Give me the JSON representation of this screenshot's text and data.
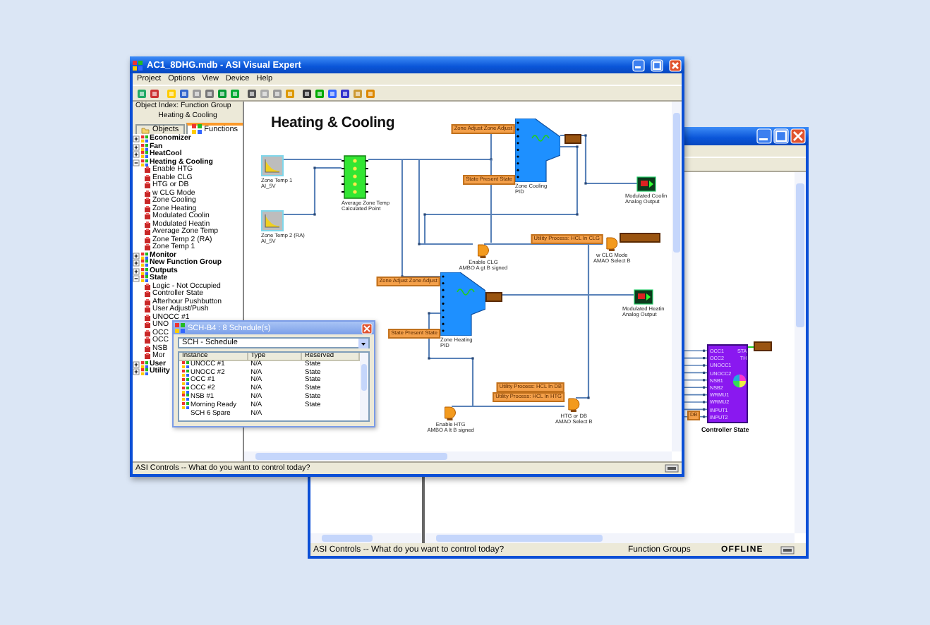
{
  "back_window": {
    "diagram": {
      "block": {
        "label": "Controller State",
        "inputs": [
          "OCC1",
          "OCC2",
          "UNOCC1",
          "UNOCC2",
          "NSB1",
          "NSB2",
          "WRMU1",
          "WRMU2",
          "INPUT1",
          "INPUT2"
        ],
        "outputs": [
          "STA",
          "TH"
        ]
      },
      "tags": [
        "DB"
      ]
    },
    "status_bar": {
      "message": "ASI Controls -- What do you want to control today?",
      "view": "Function Groups",
      "connection": "OFFLINE"
    }
  },
  "front_window": {
    "title": "AC1_8DHG.mdb - ASI Visual Expert",
    "menu": [
      "Project",
      "Options",
      "View",
      "Device",
      "Help"
    ],
    "object_index": {
      "label": "Object Index:  Function Group",
      "group": "Heating & Cooling"
    },
    "tabs": [
      {
        "label": "Objects",
        "selected": false
      },
      {
        "label": "Functions",
        "selected": true
      }
    ],
    "tree": [
      {
        "label": "Economizer",
        "expanded": false
      },
      {
        "label": "Fan",
        "expanded": false
      },
      {
        "label": "HeatCool",
        "expanded": false
      },
      {
        "label": "Heating & Cooling",
        "expanded": true,
        "children": [
          {
            "label": "Enable HTG"
          },
          {
            "label": "Enable CLG"
          },
          {
            "label": "HTG or DB"
          },
          {
            "label": "w CLG Mode"
          },
          {
            "label": "Zone Cooling"
          },
          {
            "label": "Zone Heating"
          },
          {
            "label": "Modulated Coolin"
          },
          {
            "label": "Modulated Heatin"
          },
          {
            "label": "Average Zone Temp"
          },
          {
            "label": "Zone Temp 2 (RA)"
          },
          {
            "label": "Zone Temp 1"
          }
        ]
      },
      {
        "label": "Monitor",
        "expanded": false
      },
      {
        "label": "New Function Group",
        "expanded": false
      },
      {
        "label": "Outputs",
        "expanded": false
      },
      {
        "label": "State",
        "expanded": true,
        "children": [
          {
            "label": "Logic - Not Occupied"
          },
          {
            "label": "Controller State"
          },
          {
            "label": "Afterhour Pushbutton"
          },
          {
            "label": "User Adjust/Push"
          },
          {
            "label": "UNOCC #1"
          },
          {
            "label": "UNO"
          },
          {
            "label": "OCC"
          },
          {
            "label": "OCC"
          },
          {
            "label": "NSB"
          },
          {
            "label": "Mor"
          }
        ]
      },
      {
        "label": "User",
        "expanded": false
      },
      {
        "label": "Utility",
        "expanded": false
      }
    ],
    "diagram": {
      "title": "Heating & Cooling",
      "blocks": [
        {
          "kind": "sensor",
          "label": "Zone Temp 1",
          "sublabel": "AI_5V"
        },
        {
          "kind": "sensor",
          "label": "Zone Temp 2 (RA)",
          "sublabel": "AI_5V"
        },
        {
          "kind": "calc",
          "label": "Average Zone Temp",
          "sublabel": "Calculated Point"
        },
        {
          "kind": "pid",
          "label": "Zone Cooling",
          "sublabel": "PID"
        },
        {
          "kind": "pid",
          "label": "Zone Heating",
          "sublabel": "PID"
        },
        {
          "kind": "gate",
          "label": "Enable CLG",
          "sublabel": "AMBO A gt B signed"
        },
        {
          "kind": "gate",
          "label": "w CLG Mode",
          "sublabel": "AMAO Select B"
        },
        {
          "kind": "gate",
          "label": "HTG or DB",
          "sublabel": "AMAO Select B"
        },
        {
          "kind": "gate",
          "label": "Enable HTG",
          "sublabel": "AMBO A lt B signed"
        },
        {
          "kind": "output",
          "label": "Modulated Coolin",
          "sublabel": "Analog Output"
        },
        {
          "kind": "output",
          "label": "Modulated Heatin",
          "sublabel": "Analog Output"
        }
      ],
      "tags": [
        "Zone Adjust Zone Adjust",
        "State Present State",
        "Utility Process: HCL In CLG",
        "Zone Adjust Zone Adjust",
        "State Present State",
        "Utility Process: HCL In DB",
        "Utility Process: HCL In HTG"
      ]
    },
    "status_bar": {
      "message": "ASI Controls -- What do you want to control today?"
    }
  },
  "schedule_dialog": {
    "title": "SCH-B4 : 8 Schedule(s)",
    "selector": "SCH - Schedule",
    "columns": [
      "Instance",
      "Type",
      "Reserved"
    ],
    "rows": [
      {
        "kind": "schedule",
        "instance": "UNOCC #1",
        "type": "N/A",
        "reserved": "State"
      },
      {
        "kind": "schedule",
        "instance": "UNOCC #2",
        "type": "N/A",
        "reserved": "State"
      },
      {
        "kind": "schedule",
        "instance": "OCC #1",
        "type": "N/A",
        "reserved": "State"
      },
      {
        "kind": "schedule",
        "instance": "OCC #2",
        "type": "N/A",
        "reserved": "State"
      },
      {
        "kind": "schedule",
        "instance": "NSB #1",
        "type": "N/A",
        "reserved": "State"
      },
      {
        "kind": "schedule",
        "instance": "Morning Ready",
        "type": "N/A",
        "reserved": "State"
      },
      {
        "kind": "spare",
        "instance": "SCH 6 Spare",
        "type": "N/A"
      }
    ]
  }
}
